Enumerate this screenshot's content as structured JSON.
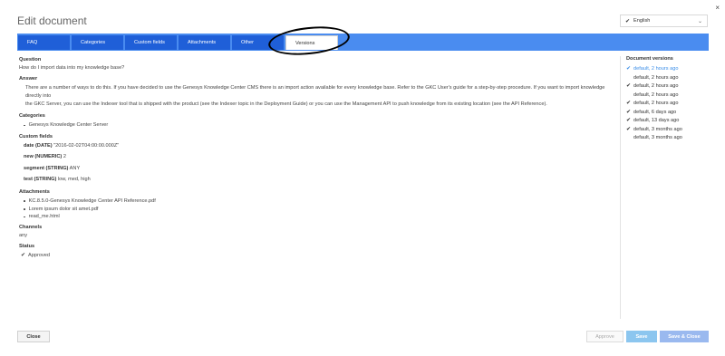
{
  "dialog": {
    "title": "Edit document",
    "close_glyph": "×",
    "language": {
      "value": "English",
      "check": "✔",
      "chevron": "⌄"
    }
  },
  "tabs": [
    {
      "label": "FAQ"
    },
    {
      "label": "Categories"
    },
    {
      "label": "Custom fields"
    },
    {
      "label": "Attachments"
    },
    {
      "label": "Other"
    },
    {
      "label": "Versions",
      "active": true
    }
  ],
  "content": {
    "question_label": "Question",
    "question": "How do I import data into my knowledge base?",
    "answer_label": "Answer",
    "answer_line1": "There are a number of ways to do this. If you have decided to use the Genesys Knowledge Center CMS there is an import action available for every knowledge base. Refer to the GKC User's guide for a step-by-step procedure. If you want to import knowledge directly into",
    "answer_line2": "the GKC Server, you can use the Indexer tool that is shipped with the product (see the Indexer topic in the Deployment Guide) or you can use the Management API to push knowledge from its existing location (see the API Reference).",
    "categories_label": "Categories",
    "categories": [
      "Genesys Knowledge Center Server"
    ],
    "custom_fields_label": "Custom fields",
    "custom_fields": [
      {
        "name": "date (DATE)",
        "value": "\"2016-02-02T04:00:00.000Z\""
      },
      {
        "name": "new (NUMERIC)",
        "value": "2"
      },
      {
        "name": "segment (STRING)",
        "value": "ANY"
      },
      {
        "name": "test (STRING)",
        "value": "low, med, high"
      }
    ],
    "attachments_label": "Attachments",
    "attachments": [
      "KC.8.5.0-Genesys Knowledge Center API Reference.pdf",
      "Lorem ipsum dolor sit amet.pdf",
      "read_me.html"
    ],
    "channels_label": "Channels",
    "channels": "any",
    "status_label": "Status",
    "status": "Approved",
    "status_check": "✔"
  },
  "versions": {
    "heading": "Document versions",
    "check": "✔",
    "items": [
      {
        "label": "default, 2 hours ago",
        "checked": true,
        "selected": true
      },
      {
        "label": "default, 2 hours ago",
        "checked": false
      },
      {
        "label": "default, 2 hours ago",
        "checked": true
      },
      {
        "label": "default, 2 hours ago",
        "checked": false
      },
      {
        "label": "default, 2 hours ago",
        "checked": true
      },
      {
        "label": "default, 6 days ago",
        "checked": true
      },
      {
        "label": "default, 13 days ago",
        "checked": true
      },
      {
        "label": "default, 3 months ago",
        "checked": true
      },
      {
        "label": "default, 3 months ago",
        "checked": false
      }
    ]
  },
  "footer": {
    "close": "Close",
    "approve": "Approve",
    "save": "Save",
    "save_close": "Save & Close"
  }
}
